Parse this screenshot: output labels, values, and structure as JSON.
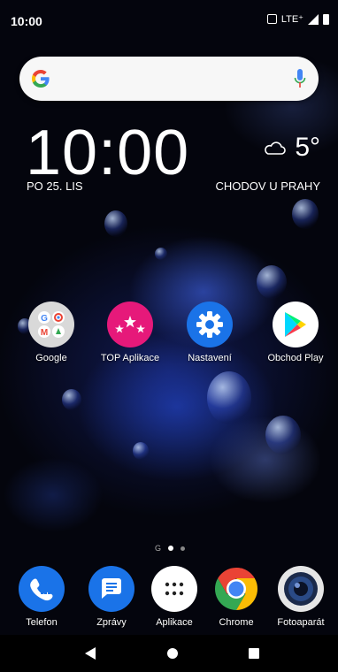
{
  "status_bar": {
    "time": "10:00",
    "network": "LTE⁺",
    "icons": [
      "vibrate-icon",
      "signal-icon",
      "battery-icon"
    ]
  },
  "search": {
    "icons": [
      "google-g-icon",
      "mic-icon"
    ]
  },
  "clock_widget": {
    "time": "10:00",
    "date": "PO 25. LIS",
    "weather_icon": "cloud-icon",
    "temperature": "5°",
    "location": "CHODOV U PRAHY"
  },
  "home_apps": [
    {
      "label": "Google",
      "icon": "google-folder-icon"
    },
    {
      "label": "TOP Aplikace",
      "icon": "stars-icon",
      "color": "#e6197a"
    },
    {
      "label": "Nastavení",
      "icon": "gear-icon",
      "color": "#1a73e8"
    },
    {
      "label": "Obchod Play",
      "icon": "play-store-icon"
    }
  ],
  "page_indicator": {
    "label": "G",
    "pages": 3,
    "current": 1
  },
  "dock_apps": [
    {
      "label": "Telefon",
      "icon": "phone-icon",
      "color": "#1a73e8"
    },
    {
      "label": "Zprávy",
      "icon": "messages-icon",
      "color": "#1a73e8"
    },
    {
      "label": "Aplikace",
      "icon": "app-drawer-icon"
    },
    {
      "label": "Chrome",
      "icon": "chrome-icon"
    },
    {
      "label": "Fotoaparát",
      "icon": "camera-icon"
    }
  ],
  "nav_bar": {
    "buttons": [
      "back-icon",
      "home-icon",
      "recents-icon"
    ]
  }
}
